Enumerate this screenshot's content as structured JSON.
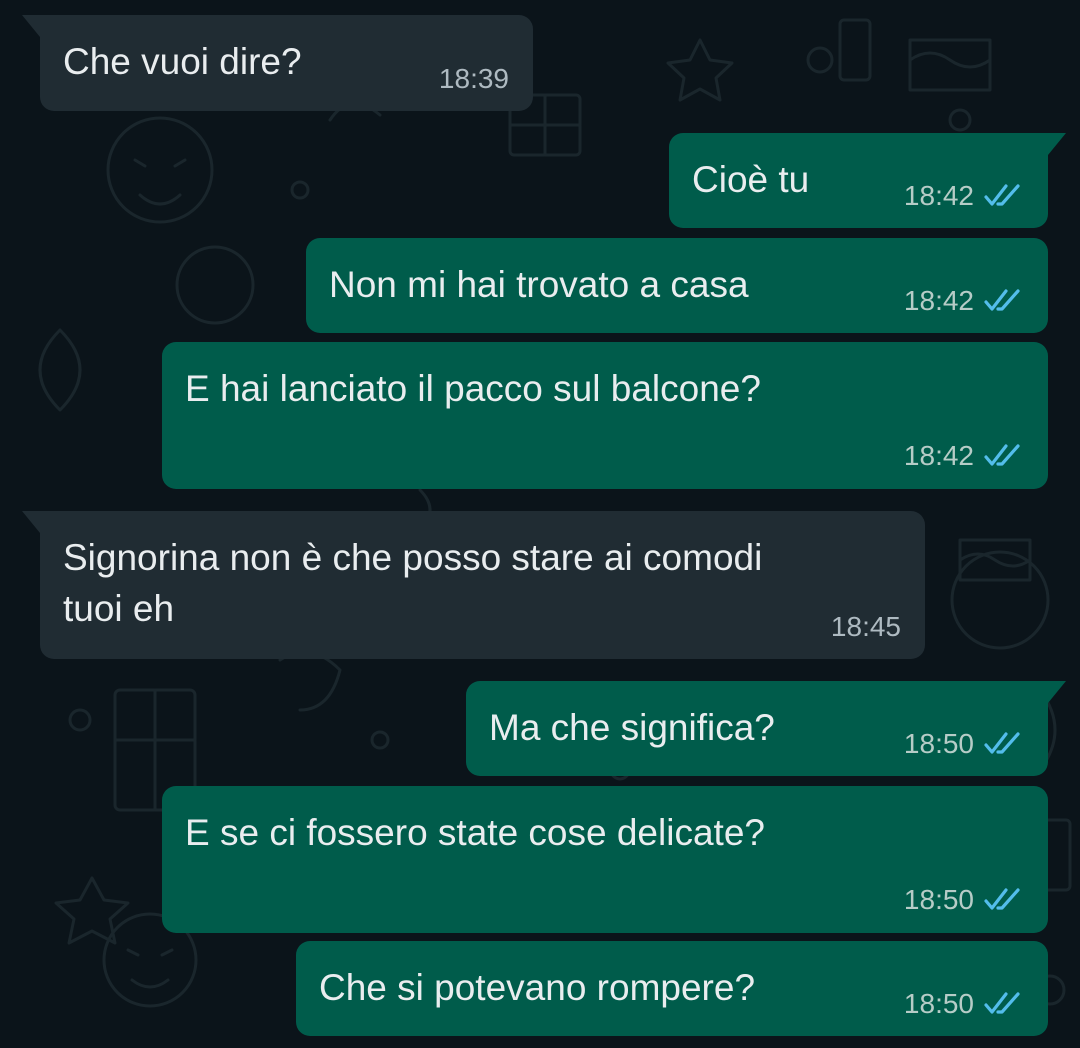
{
  "chat": {
    "messages": [
      {
        "direction": "in",
        "text": "Che vuoi dire?",
        "time": "18:39"
      },
      {
        "direction": "out",
        "text": "Cioè tu",
        "time": "18:42",
        "status": "read"
      },
      {
        "direction": "out",
        "text": "Non mi hai trovato a casa",
        "time": "18:42",
        "status": "read"
      },
      {
        "direction": "out",
        "text": "E hai lanciato il pacco sul balcone?",
        "time": "18:42",
        "status": "read"
      },
      {
        "direction": "in",
        "text_line1": "Signorina non è che posso stare ai comodi",
        "text_line2": "tuoi eh",
        "time": "18:45"
      },
      {
        "direction": "out",
        "text": "Ma che significa?",
        "time": "18:50",
        "status": "read"
      },
      {
        "direction": "out",
        "text": "E se ci fossero state cose delicate?",
        "time": "18:50",
        "status": "read"
      },
      {
        "direction": "out",
        "text": "Che si potevano rompere?",
        "time": "18:50",
        "status": "read"
      }
    ]
  },
  "icons": {
    "read_receipt": "double-check-icon"
  },
  "colors": {
    "background": "#0b141a",
    "incoming_bubble": "#202c33",
    "outgoing_bubble": "#005c4b",
    "message_text": "#e9edef",
    "timestamp": "#aebac1",
    "read_ticks": "#53bdeb"
  }
}
